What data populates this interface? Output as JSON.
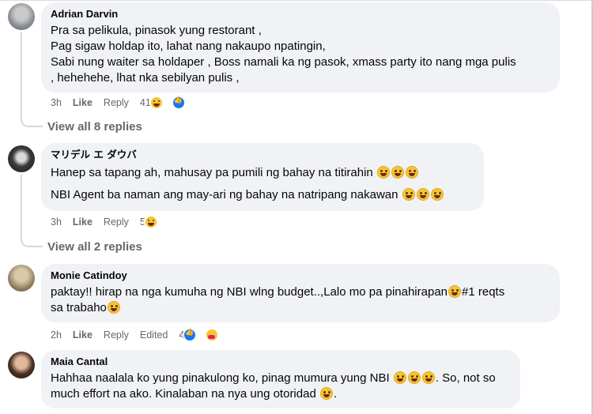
{
  "comments": [
    {
      "author": "Adrian Darvin",
      "lines": [
        "Pra sa pelikula, pinasok yung restorant ,",
        "Pag sigaw holdap ito, lahat nang nakaupo npatingin,",
        "Sabi nung waiter sa holdaper , Boss namali ka ng pasok, xmass party ito nang mga pulis",
        ", hehehehe, lhat nka sebilyan pulis ,"
      ],
      "time": "3h",
      "like": "Like",
      "reply": "Reply",
      "reactions": "41",
      "view_replies": "View all 8 replies"
    },
    {
      "author": "マリデル エ ダウバ",
      "line1": "Hanep sa tapang ah, mahusay pa pumili ng bahay na titirahin",
      "line2": "NBI Agent ba naman ang may-ari ng bahay na natripang nakawan",
      "time": "3h",
      "like": "Like",
      "reply": "Reply",
      "reactions": "5",
      "view_replies": "View all 2 replies"
    },
    {
      "author": "Monie Catindoy",
      "line1a": "paktay!! hirap na nga kumuha ng NBI wlng budget..,Lalo mo pa pinahirapan",
      "line1b": "#1 reqts",
      "line2": "sa trabaho",
      "time": "2h",
      "like": "Like",
      "reply": "Reply",
      "edited": "Edited",
      "reactions": "4"
    },
    {
      "author": "Maia Cantal",
      "line1a": "Hahhaa naalala ko yung pinakulong ko, pinag mumura yung NBI",
      "line1b": ". So, not so",
      "line2": "much effort na ako. Kinalaban na nya ung otoridad"
    }
  ],
  "icons": {
    "laugh": "laughing-emoji-icon",
    "rofl": "rolling-laughing-emoji-icon",
    "tear": "crying-emoji-icon",
    "like_reaction": "like-reaction-icon",
    "haha_reaction": "haha-reaction-icon",
    "care_reaction": "care-reaction-icon"
  }
}
